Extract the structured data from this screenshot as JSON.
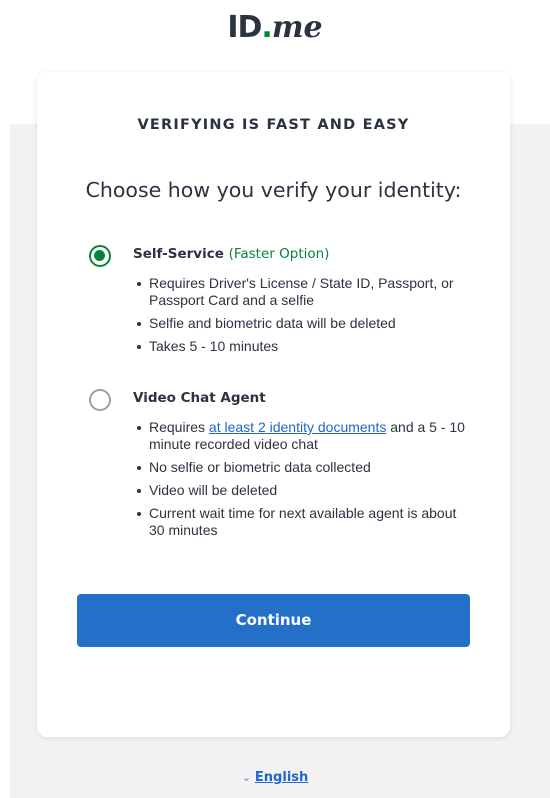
{
  "logo": {
    "id": "ID",
    "dot": ".",
    "me": "me"
  },
  "card": {
    "eyebrow": "VERIFYING IS FAST AND EASY",
    "heading": "Choose how you verify your identity:",
    "options": [
      {
        "title": "Self-Service",
        "tag": "(Faster Option)",
        "selected": true,
        "bullets": [
          "Requires Driver's License / State ID, Passport, or Passport Card and a selfie",
          "Selfie and biometric data will be deleted",
          "Takes 5 - 10 minutes"
        ]
      },
      {
        "title": "Video Chat Agent",
        "selected": false,
        "bullet1_prefix": "Requires ",
        "bullet1_link": "at least 2 identity documents",
        "bullet1_suffix": " and a 5 - 10 minute recorded video chat",
        "bullets": [
          "No selfie or biometric data collected",
          "Video will be deleted",
          "Current wait time for next available agent is about 30 minutes"
        ]
      }
    ],
    "continue_label": "Continue"
  },
  "footer": {
    "language": "English"
  },
  "colors": {
    "brand_green": "#08833d",
    "button_blue": "#2470c9",
    "link_blue": "#2166c9"
  }
}
